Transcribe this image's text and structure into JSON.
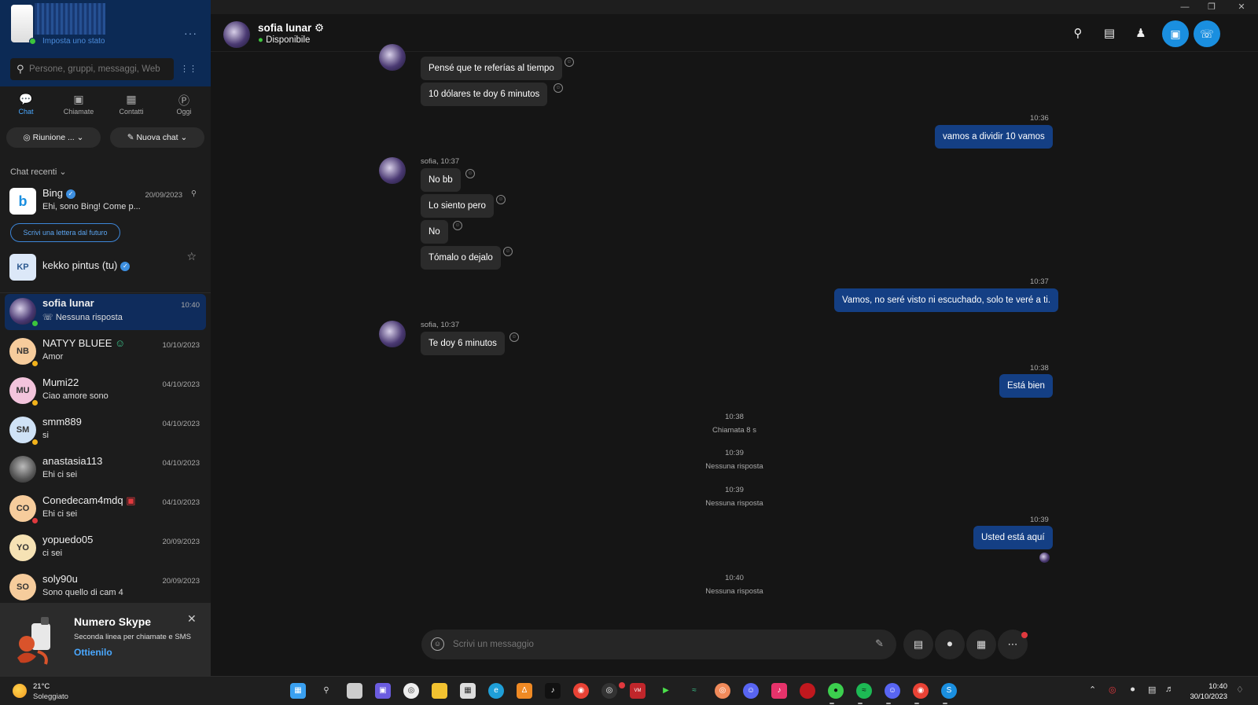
{
  "window": {
    "minimize": "—",
    "maximize": "❐",
    "close": "✕"
  },
  "profile": {
    "set_status": "Imposta uno stato",
    "more": "···"
  },
  "search": {
    "placeholder": "Persone, gruppi, messaggi, Web"
  },
  "tabs": [
    {
      "label": "Chat",
      "icon": "chat-icon"
    },
    {
      "label": "Chiamate",
      "icon": "video-icon"
    },
    {
      "label": "Contatti",
      "icon": "contacts-icon"
    },
    {
      "label": "Oggi",
      "icon": "skype-icon"
    }
  ],
  "buttons": {
    "meeting": "Riunione ...",
    "new_chat": "Nuova chat"
  },
  "recent_label": "Chat recenti",
  "future_letter": "Scrivi una lettera dal futuro",
  "chats": [
    {
      "name": "Bing",
      "sub": "Ehi, sono Bing! Come p...",
      "date": "20/09/2023",
      "initials": ""
    },
    {
      "name": "kekko pintus (tu)",
      "sub": "",
      "date": "",
      "initials": "KP"
    },
    {
      "name": "sofia lunar",
      "sub": "Nessuna risposta",
      "date": "10:40",
      "initials": ""
    },
    {
      "name": "NATYY BLUEE",
      "sub": "Amor",
      "date": "10/10/2023",
      "initials": "NB"
    },
    {
      "name": "Mumi22",
      "sub": "Ciao amore sono",
      "date": "04/10/2023",
      "initials": "MU"
    },
    {
      "name": "smm889",
      "sub": "si",
      "date": "04/10/2023",
      "initials": "SM"
    },
    {
      "name": "anastasia113",
      "sub": "Ehi ci sei",
      "date": "04/10/2023",
      "initials": ""
    },
    {
      "name": "Conedecam4mdq",
      "sub": "Ehi ci sei",
      "date": "04/10/2023",
      "initials": "CO"
    },
    {
      "name": "yopuedo05",
      "sub": "ci sei",
      "date": "20/09/2023",
      "initials": "YO"
    },
    {
      "name": "soly90u",
      "sub": "Sono quello di cam 4",
      "date": "20/09/2023",
      "initials": "SO"
    }
  ],
  "promo": {
    "title": "Numero Skype",
    "subtitle": "Seconda linea per chiamate e SMS",
    "link": "Ottienilo"
  },
  "header": {
    "name": "sofia lunar",
    "status": "Disponibile"
  },
  "messages": {
    "m1": "Pensé que te referías al tiempo",
    "m2": "10 dólares te doy 6 minutos",
    "t1036": "10:36",
    "o1": "vamos a dividir 10 vamos",
    "meta2": "sofia, 10:37",
    "m3": "No bb",
    "m4": "Lo siento pero",
    "m5": "No",
    "m6": "Tómalo o dejalo",
    "t1037": "10:37",
    "o2": "Vamos, no seré visto ni escuchado, solo te veré a ti.",
    "meta3": "sofia, 10:37",
    "m7": "Te doy 6 minutos",
    "t1038": "10:38",
    "o3": "Está bien",
    "s1_time": "10:38",
    "s1_text": "Chiamata 8 s",
    "s2_time": "10:39",
    "s2_text": "Nessuna risposta",
    "s3_time": "10:39",
    "s3_text": "Nessuna risposta",
    "t1039": "10:39",
    "o4": "Usted está aquí",
    "s4_time": "10:40",
    "s4_text": "Nessuna risposta"
  },
  "composer": {
    "placeholder": "Scrivi un messaggio"
  },
  "taskbar": {
    "temp": "21°C",
    "weather": "Soleggiato",
    "time": "10:40",
    "date": "30/10/2023"
  },
  "colors": {
    "accent": "#1a8fe0",
    "outgoing": "#143f84",
    "incoming": "#2b2b2b",
    "online": "#3cc53c",
    "away": "#f2b21a"
  }
}
